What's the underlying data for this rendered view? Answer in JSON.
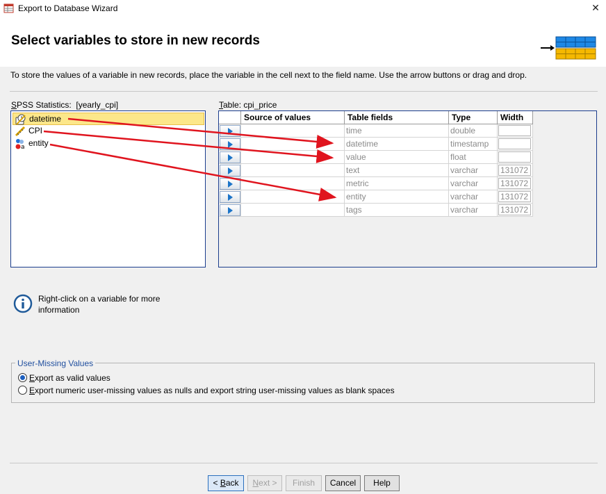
{
  "window": {
    "title": "Export to Database Wizard",
    "close_glyph": "✕"
  },
  "header": {
    "title": "Select variables to store in new records"
  },
  "description": "To store the values of a variable in new records, place the variable in the cell next to the field name. Use the arrow buttons or drag and drop.",
  "spss_panel": {
    "label_prefix_underlined": "S",
    "label_rest": "PSS Statistics:",
    "dataset": "[yearly_cpi]",
    "variables": [
      {
        "name": "datetime",
        "icon": "date-variable-icon",
        "selected": true
      },
      {
        "name": "CPI",
        "icon": "scale-variable-icon",
        "selected": false
      },
      {
        "name": "entity",
        "icon": "nominal-variable-icon",
        "selected": false
      }
    ]
  },
  "table_panel": {
    "label_prefix_underlined": "T",
    "label_rest": "able: cpi_price",
    "columns": [
      "Source of values",
      "Table fields",
      "Type",
      "Width"
    ],
    "rows": [
      {
        "source": "",
        "field": "time",
        "type": "double",
        "width": ""
      },
      {
        "source": "",
        "field": "datetime",
        "type": "timestamp",
        "width": ""
      },
      {
        "source": "",
        "field": "value",
        "type": "float",
        "width": ""
      },
      {
        "source": "",
        "field": "text",
        "type": "varchar",
        "width": "131072"
      },
      {
        "source": "",
        "field": "metric",
        "type": "varchar",
        "width": "131072"
      },
      {
        "source": "",
        "field": "entity",
        "type": "varchar",
        "width": "131072"
      },
      {
        "source": "",
        "field": "tags",
        "type": "varchar",
        "width": "131072"
      }
    ]
  },
  "info": {
    "text": "Right-click on a variable for more information"
  },
  "user_missing": {
    "title": "User-Missing Values",
    "options": [
      {
        "underlined": "E",
        "rest": "xport as valid values",
        "checked": true
      },
      {
        "underlined": "E",
        "rest": "xport numeric user-missing values as nulls and export string user-missing values as blank spaces",
        "checked": false
      }
    ]
  },
  "buttons": {
    "back": {
      "prefix": "< ",
      "underlined": "B",
      "rest": "ack"
    },
    "next": {
      "underlined": "N",
      "rest": "ext >"
    },
    "finish": "Finish",
    "cancel": "Cancel",
    "help": "Help"
  },
  "colors": {
    "annotation_arrow": "#e0141e",
    "selection": "#fce78a",
    "panel_border": "#1a3c8c",
    "accent": "#1c74c8"
  }
}
